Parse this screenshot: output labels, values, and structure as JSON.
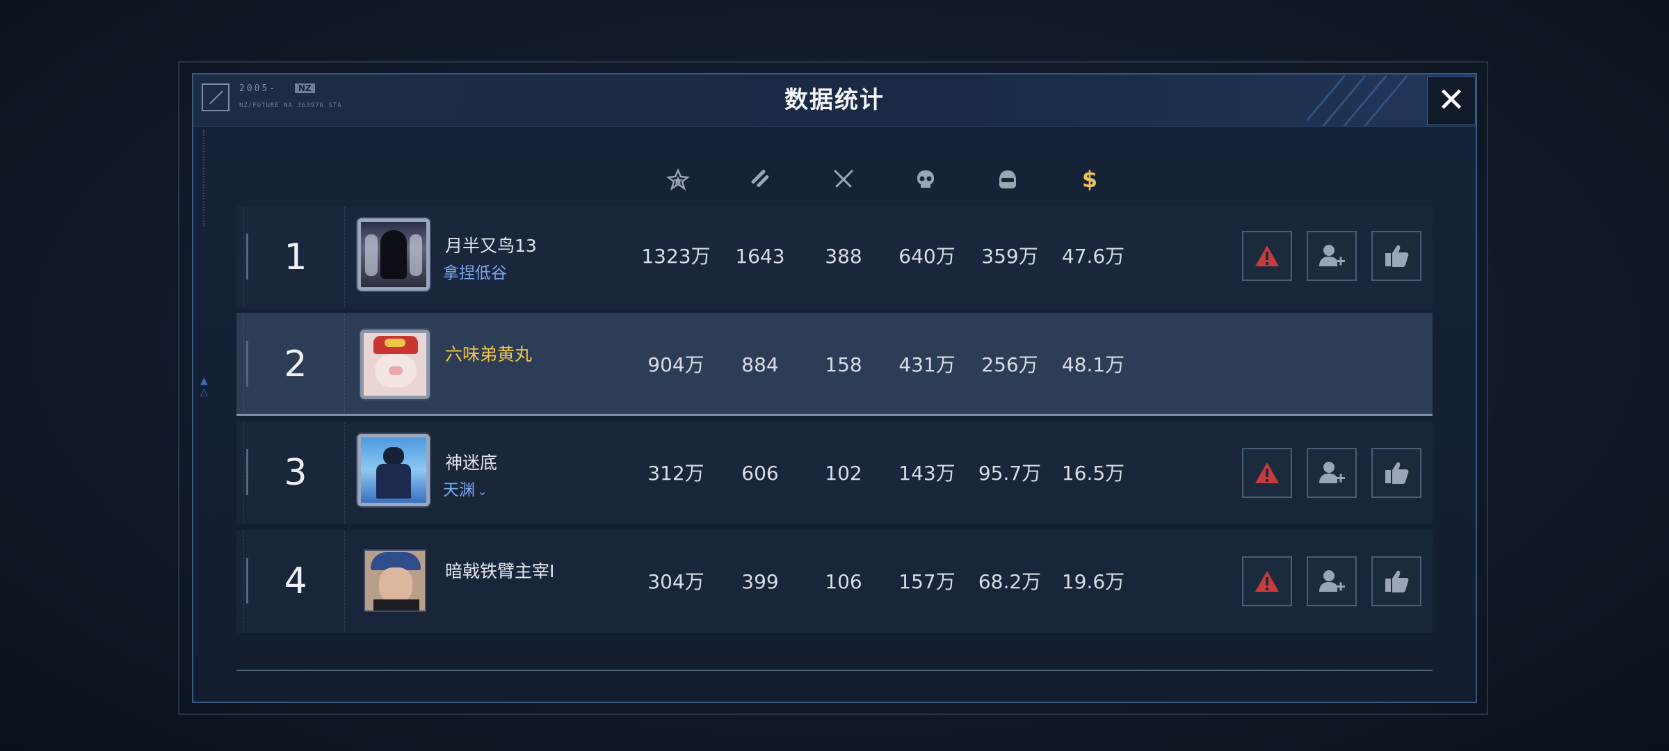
{
  "window": {
    "title": "数据统计",
    "logo_code": "2005-",
    "logo_badge": "NZ",
    "logo_subtext": "NZ/FUTURE NA 363976 STA",
    "close_label": "✕"
  },
  "columns": [
    {
      "icon": "star-rank-icon"
    },
    {
      "icon": "bullets-icon"
    },
    {
      "icon": "crossed-swords-icon"
    },
    {
      "icon": "skull-icon"
    },
    {
      "icon": "helmet-icon"
    },
    {
      "icon": "dollar-icon"
    }
  ],
  "players": [
    {
      "rank": "1",
      "name": "月半又鸟13",
      "sub": "拿捏低谷",
      "stats": [
        "1323万",
        "1643",
        "388",
        "640万",
        "359万",
        "47.6万"
      ],
      "is_self": false
    },
    {
      "rank": "2",
      "name": "六味弟黄丸",
      "sub": "",
      "stats": [
        "904万",
        "884",
        "158",
        "431万",
        "256万",
        "48.1万"
      ],
      "is_self": true
    },
    {
      "rank": "3",
      "name": "神迷底",
      "sub": "天渊",
      "stats": [
        "312万",
        "606",
        "102",
        "143万",
        "95.7万",
        "16.5万"
      ],
      "is_self": false
    },
    {
      "rank": "4",
      "name": "暗戟铁臂主宰I",
      "sub": "",
      "stats": [
        "304万",
        "399",
        "106",
        "157万",
        "68.2万",
        "19.6万"
      ],
      "is_self": false
    }
  ],
  "colors": {
    "accent_gold": "#f0c64a",
    "sub_blue": "#7aa6ee",
    "report_red": "#c63b3b",
    "dollar_gold": "#e8c25a"
  }
}
